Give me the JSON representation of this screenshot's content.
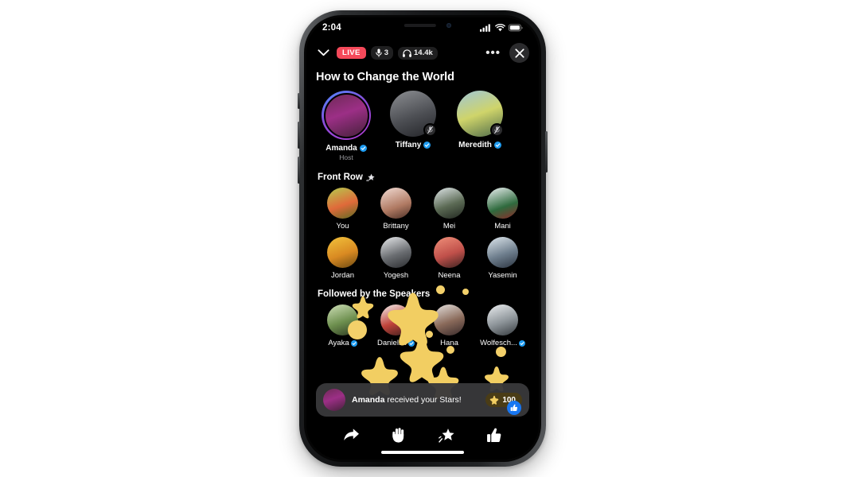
{
  "status_bar": {
    "time": "2:04",
    "cellular_icon": "cellular-bars-icon",
    "wifi_icon": "wifi-icon",
    "battery_icon": "battery-icon"
  },
  "header": {
    "collapse_icon": "chevron-down-icon",
    "live_label": "LIVE",
    "mic_icon": "microphone-icon",
    "speaker_count": "3",
    "headphones_icon": "headphones-icon",
    "listener_count": "14.4k",
    "more_label": "•••",
    "close_icon": "close-icon"
  },
  "room": {
    "title": "How to Change the World"
  },
  "speakers": [
    {
      "name": "Amanda",
      "role": "Host",
      "verified": true,
      "active": true,
      "muted": false,
      "portrait": "p1"
    },
    {
      "name": "Tiffany",
      "role": "",
      "verified": true,
      "active": false,
      "muted": true,
      "portrait": "p2"
    },
    {
      "name": "Meredith",
      "role": "",
      "verified": true,
      "active": false,
      "muted": true,
      "portrait": "p3"
    }
  ],
  "front_row": {
    "label": "Front Row",
    "icon": "sparkle-star-icon",
    "members": [
      {
        "name": "You",
        "verified": false,
        "portrait": "p4"
      },
      {
        "name": "Brittany",
        "verified": false,
        "portrait": "p5"
      },
      {
        "name": "Mei",
        "verified": false,
        "portrait": "p6"
      },
      {
        "name": "Mani",
        "verified": false,
        "portrait": "p7"
      },
      {
        "name": "Jordan",
        "verified": false,
        "portrait": "p8"
      },
      {
        "name": "Yogesh",
        "verified": false,
        "portrait": "p9"
      },
      {
        "name": "Neena",
        "verified": false,
        "portrait": "p10"
      },
      {
        "name": "Yasemin",
        "verified": false,
        "portrait": "p11"
      }
    ]
  },
  "followed_by": {
    "label": "Followed by the Speakers",
    "members": [
      {
        "name": "Ayaka",
        "verified": true,
        "portrait": "p12"
      },
      {
        "name": "Daniell...",
        "verified": true,
        "portrait": "p13"
      },
      {
        "name": "Hana",
        "verified": false,
        "portrait": "p14"
      },
      {
        "name": "Wolfesch...",
        "verified": true,
        "portrait": "p15"
      }
    ]
  },
  "toast": {
    "name": "Amanda",
    "message": " received your Stars!",
    "star_icon": "star-icon",
    "star_count": "100"
  },
  "toolbar": {
    "share_icon": "share-arrow-icon",
    "raise_hand_icon": "raised-hand-icon",
    "send_star_icon": "star-icon",
    "like_icon": "thumbs-up-icon",
    "like_badge_icon": "thumbs-up-badge-icon"
  },
  "colors": {
    "live_red": "#f5495a",
    "verified_blue": "#1d9bf0",
    "star_yellow": "#f2cf63",
    "like_blue": "#1877f2",
    "screen_black": "#000000"
  }
}
